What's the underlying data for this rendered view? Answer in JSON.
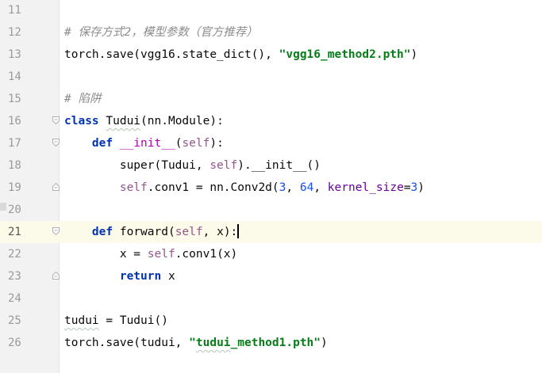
{
  "editor": {
    "current_line": "21",
    "lines": [
      {
        "num": "11",
        "tokens": []
      },
      {
        "num": "12",
        "tokens": [
          {
            "t": "# 保存方式2，模型参数（官方推荐）",
            "c": "cmt"
          }
        ]
      },
      {
        "num": "13",
        "tokens": [
          {
            "t": "torch.save(vgg16.state_dict(), ",
            "c": "plain"
          },
          {
            "t": "\"vgg16_method2.pth\"",
            "c": "str"
          },
          {
            "t": ")",
            "c": "plain"
          }
        ]
      },
      {
        "num": "14",
        "tokens": []
      },
      {
        "num": "15",
        "tokens": [
          {
            "t": "# 陷阱",
            "c": "cmt"
          }
        ]
      },
      {
        "num": "16",
        "fold": "open",
        "tokens": [
          {
            "t": "class",
            "c": "kw"
          },
          {
            "t": " ",
            "c": "plain"
          },
          {
            "t": "Tudui",
            "c": "plain squiggle"
          },
          {
            "t": "(nn.Module):",
            "c": "plain"
          }
        ]
      },
      {
        "num": "17",
        "fold": "open",
        "tokens": [
          {
            "t": "    ",
            "c": "plain"
          },
          {
            "t": "def",
            "c": "kw"
          },
          {
            "t": " ",
            "c": "plain"
          },
          {
            "t": "__init__",
            "c": "dunder"
          },
          {
            "t": "(",
            "c": "plain"
          },
          {
            "t": "self",
            "c": "self"
          },
          {
            "t": "):",
            "c": "plain"
          }
        ]
      },
      {
        "num": "18",
        "tokens": [
          {
            "t": "        super(Tudui, ",
            "c": "plain"
          },
          {
            "t": "self",
            "c": "self"
          },
          {
            "t": ").__init__()",
            "c": "plain"
          }
        ]
      },
      {
        "num": "19",
        "fold": "close",
        "tokens": [
          {
            "t": "        ",
            "c": "plain"
          },
          {
            "t": "self",
            "c": "self"
          },
          {
            "t": ".conv1 = nn.Conv2d(",
            "c": "plain"
          },
          {
            "t": "3",
            "c": "num"
          },
          {
            "t": ", ",
            "c": "plain"
          },
          {
            "t": "64",
            "c": "num"
          },
          {
            "t": ", ",
            "c": "plain"
          },
          {
            "t": "kernel_size",
            "c": "param"
          },
          {
            "t": "=",
            "c": "plain"
          },
          {
            "t": "3",
            "c": "num"
          },
          {
            "t": ")",
            "c": "plain"
          }
        ]
      },
      {
        "num": "20",
        "tokens": []
      },
      {
        "num": "21",
        "fold": "open",
        "caret": true,
        "tokens": [
          {
            "t": "    ",
            "c": "plain"
          },
          {
            "t": "def",
            "c": "kw"
          },
          {
            "t": " forward(",
            "c": "plain"
          },
          {
            "t": "self",
            "c": "self"
          },
          {
            "t": ", x):",
            "c": "plain"
          }
        ]
      },
      {
        "num": "22",
        "tokens": [
          {
            "t": "        x = ",
            "c": "plain"
          },
          {
            "t": "self",
            "c": "self"
          },
          {
            "t": ".conv1(x)",
            "c": "plain"
          }
        ]
      },
      {
        "num": "23",
        "fold": "close",
        "tokens": [
          {
            "t": "        ",
            "c": "plain"
          },
          {
            "t": "return",
            "c": "kw"
          },
          {
            "t": " x",
            "c": "plain"
          }
        ]
      },
      {
        "num": "24",
        "tokens": []
      },
      {
        "num": "25",
        "tokens": [
          {
            "t": "tudui",
            "c": "plain squiggle"
          },
          {
            "t": " = Tudui()",
            "c": "plain"
          }
        ]
      },
      {
        "num": "26",
        "tokens": [
          {
            "t": "torch.save(tudui, ",
            "c": "plain"
          },
          {
            "t": "\"",
            "c": "str"
          },
          {
            "t": "tudui",
            "c": "str squiggle"
          },
          {
            "t": "_method1.pth\"",
            "c": "str"
          },
          {
            "t": ")",
            "c": "plain"
          }
        ]
      }
    ]
  }
}
